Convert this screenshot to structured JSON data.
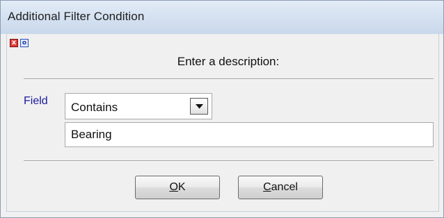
{
  "window": {
    "title": "Additional Filter Condition"
  },
  "toolbar": {
    "close_glyph": "x",
    "info_glyph": "o"
  },
  "prompt": "Enter a description:",
  "field": {
    "label": "Field",
    "operator": {
      "selected": "Contains"
    },
    "value": "Bearing"
  },
  "buttons": {
    "ok": {
      "mnemonic": "O",
      "rest": "K"
    },
    "cancel": {
      "mnemonic": "C",
      "rest": "ancel"
    }
  },
  "colors": {
    "field_label": "#1a1a9a",
    "titlebar": "#d6e2f1",
    "client_bg": "#f0f0f0"
  }
}
